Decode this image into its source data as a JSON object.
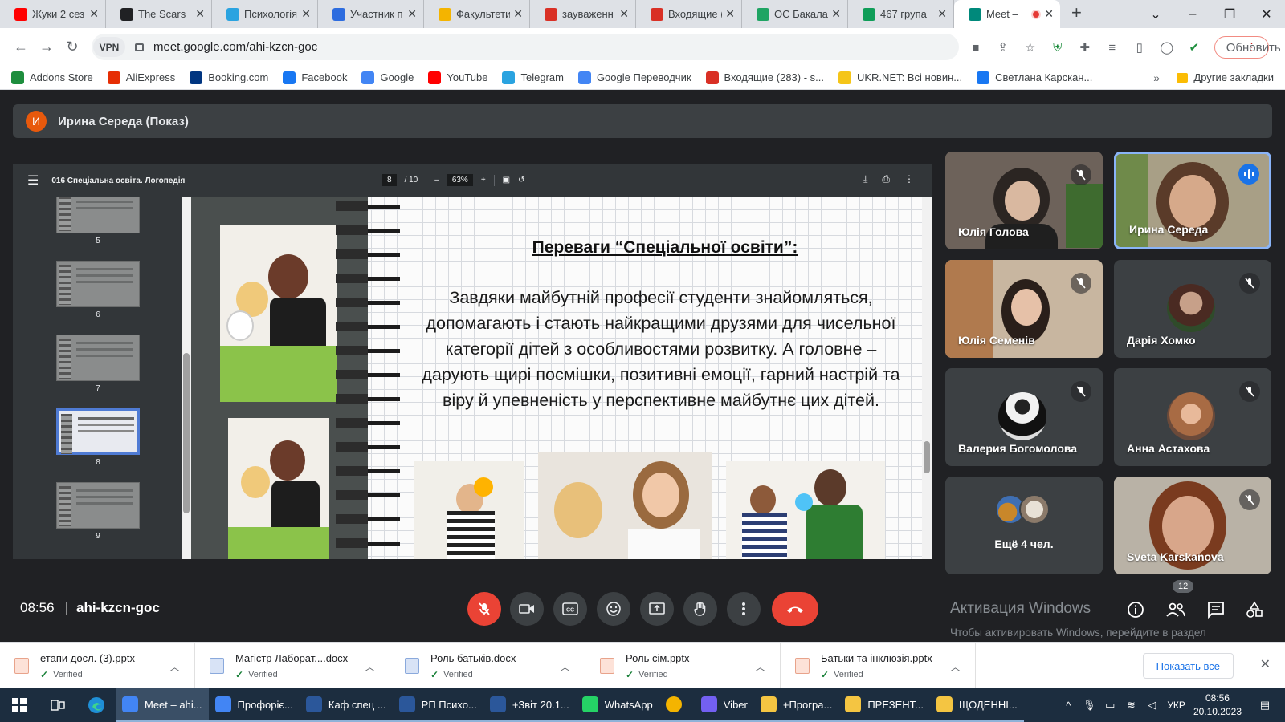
{
  "browser": {
    "tabs": [
      {
        "title": "Жуки 2 сез",
        "icon": "youtube-icon",
        "color": "#ff0000"
      },
      {
        "title": "The Scars",
        "icon": "genius-icon",
        "color": "#202124"
      },
      {
        "title": "Психологія",
        "icon": "telegram-icon",
        "color": "#2aa3e0"
      },
      {
        "title": "Участник п",
        "icon": "zoom-icon",
        "color": "#2d6cdf"
      },
      {
        "title": "Факультети",
        "icon": "university-icon",
        "color": "#f4b400"
      },
      {
        "title": "зауваженн",
        "icon": "gmail-icon",
        "color": "#d93025"
      },
      {
        "title": "Входящие (",
        "icon": "gmail-icon",
        "color": "#d93025"
      },
      {
        "title": "ОС Бакала",
        "icon": "drive-icon",
        "color": "#1fa463"
      },
      {
        "title": "467 група",
        "icon": "sheets-icon",
        "color": "#0f9d58"
      },
      {
        "title": "Meet –",
        "icon": "meet-icon",
        "color": "#00897b",
        "active": true
      }
    ],
    "url": "meet.google.com/ahi-kzcn-goc",
    "vpn_label": "VPN",
    "update_button": "Обновить",
    "bookmarks": [
      {
        "label": "Addons Store",
        "icon": "addons-icon",
        "color": "#1e8e3e"
      },
      {
        "label": "AliExpress",
        "icon": "aliexpress-icon",
        "color": "#e62e04"
      },
      {
        "label": "Booking.com",
        "icon": "booking-icon",
        "color": "#003580"
      },
      {
        "label": "Facebook",
        "icon": "facebook-icon",
        "color": "#1877f2"
      },
      {
        "label": "Google",
        "icon": "google-icon",
        "color": "#4285f4"
      },
      {
        "label": "YouTube",
        "icon": "youtube-icon",
        "color": "#ff0000"
      },
      {
        "label": "Telegram",
        "icon": "telegram-icon",
        "color": "#2aa3e0"
      },
      {
        "label": "Google Переводчик",
        "icon": "translate-icon",
        "color": "#4285f4"
      },
      {
        "label": "Входящие (283) - s...",
        "icon": "gmail-icon",
        "color": "#d93025"
      },
      {
        "label": "UKR.NET: Всі новин...",
        "icon": "ukrnet-icon",
        "color": "#f5c518"
      },
      {
        "label": "Светлана Карскан...",
        "icon": "facebook-icon",
        "color": "#1877f2"
      }
    ],
    "bookmarks_more": "»",
    "other_bookmarks": "Другие закладки"
  },
  "meet": {
    "presenter_initial": "И",
    "presenter_label": "Ирина Середа (Показ)",
    "time": "08:56",
    "meeting_code": "ahi-kzcn-goc",
    "people_count": "12",
    "participants": [
      {
        "name": "Юлія Голова",
        "muted": true
      },
      {
        "name": "Ирина Середа",
        "speaking": true
      },
      {
        "name": "Юлія Семенів",
        "muted": true
      },
      {
        "name": "Дарія Хомко",
        "muted": true
      },
      {
        "name": "Валерия Богомолова",
        "muted": true
      },
      {
        "name": "Анна Астахова",
        "muted": true
      },
      {
        "name": "Ещё 4 чел."
      },
      {
        "name": "Sveta Karskanova",
        "muted": true
      }
    ],
    "accent_red": "#ea4335",
    "speaking_blue": "#8ab4f8"
  },
  "pdf": {
    "doc_title": "016 Спеціальна освіта. Логопедія",
    "page_current": "8",
    "page_total": "/ 10",
    "zoom": "63%",
    "thumbnails": [
      "5",
      "6",
      "7",
      "8",
      "9"
    ],
    "active_thumbnail": "8"
  },
  "slide": {
    "title": "Переваги “Спеціальної освіти”:",
    "body": "Завдяки майбутній професії студенти знайомляться, допомагають і стають найкращими друзями для чисельної категорії дітей з особливостями розвитку. А головне –  дарують щирі посмішки, позитивні емоції, гарний настрій та віру й упевненість у перспективне майбутнє цих дітей."
  },
  "windows_activation": {
    "title": "Активация Windows",
    "subtitle": "Чтобы активировать Windows, перейдите в раздел \"Параметры\"."
  },
  "downloads": [
    {
      "name": "етапи досл. (3).pptx",
      "status": "Verified",
      "type": "ppt"
    },
    {
      "name": "Магістр Лаборат....docx",
      "status": "Verified",
      "type": "doc"
    },
    {
      "name": "Роль батьків.docx",
      "status": "Verified",
      "type": "doc"
    },
    {
      "name": "Роль сім.pptx",
      "status": "Verified",
      "type": "ppt"
    },
    {
      "name": "Батьки та інклюзія.pptx",
      "status": "Verified",
      "type": "ppt"
    }
  ],
  "downloads_show_all": "Показать все",
  "taskbar": {
    "items": [
      {
        "label": "Meet – ahi...",
        "icon": "chrome-icon",
        "color": "#4285f4",
        "active": true
      },
      {
        "label": "Профоріє...",
        "icon": "chrome-icon",
        "color": "#4285f4"
      },
      {
        "label": "Каф спец ...",
        "icon": "word-icon",
        "color": "#2b579a"
      },
      {
        "label": "РП Психо...",
        "icon": "word-icon",
        "color": "#2b579a"
      },
      {
        "label": "+Звіт 20.1...",
        "icon": "word-icon",
        "color": "#2b579a"
      },
      {
        "label": "WhatsApp",
        "icon": "whatsapp-icon",
        "color": "#25d366"
      },
      {
        "label": "",
        "icon": "weather-icon",
        "color": "#f4b400"
      },
      {
        "label": "Viber",
        "icon": "viber-icon",
        "color": "#7360f2"
      },
      {
        "label": "+Програ...",
        "icon": "folder-icon",
        "color": "#f4c542"
      },
      {
        "label": "ПРЕЗЕНТ...",
        "icon": "folder-icon",
        "color": "#f4c542"
      },
      {
        "label": "ЩОДЕННІ...",
        "icon": "folder-icon",
        "color": "#f4c542"
      }
    ],
    "language": "УКР",
    "time": "08:56",
    "date": "20.10.2023"
  }
}
